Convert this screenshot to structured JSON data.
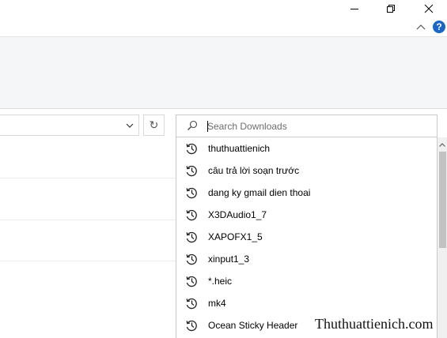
{
  "window": {
    "minimize_icon": "minimize-icon",
    "restore_icon": "restore-icon",
    "close_icon": "close-icon"
  },
  "ribbon": {
    "collapse_icon": "chevron-up-icon",
    "help_label": "?"
  },
  "address": {
    "dropdown_icon": "chevron-down-icon",
    "refresh_label": "↻"
  },
  "search": {
    "placeholder": "Search Downloads",
    "value": "",
    "icon": "search-icon"
  },
  "suggestions": [
    {
      "label": "thuthuattienich",
      "icon": "history-icon"
    },
    {
      "label": "câu trả lời soạn trước",
      "icon": "history-icon"
    },
    {
      "label": "dang ky gmail dien thoai",
      "icon": "history-icon"
    },
    {
      "label": "X3DAudio1_7",
      "icon": "history-icon"
    },
    {
      "label": "XAPOFX1_5",
      "icon": "history-icon"
    },
    {
      "label": "xinput1_3",
      "icon": "history-icon"
    },
    {
      "label": "*.heic",
      "icon": "history-icon"
    },
    {
      "label": "mk4",
      "icon": "history-icon"
    },
    {
      "label": "Ocean Sticky Header",
      "icon": "history-icon"
    }
  ],
  "watermark": "Thuthuattienich.com",
  "colors": {
    "help_blue": "#1a66c8",
    "ribbon_bg": "#f5f6f7",
    "scroll_thumb": "#c2c2c2"
  }
}
